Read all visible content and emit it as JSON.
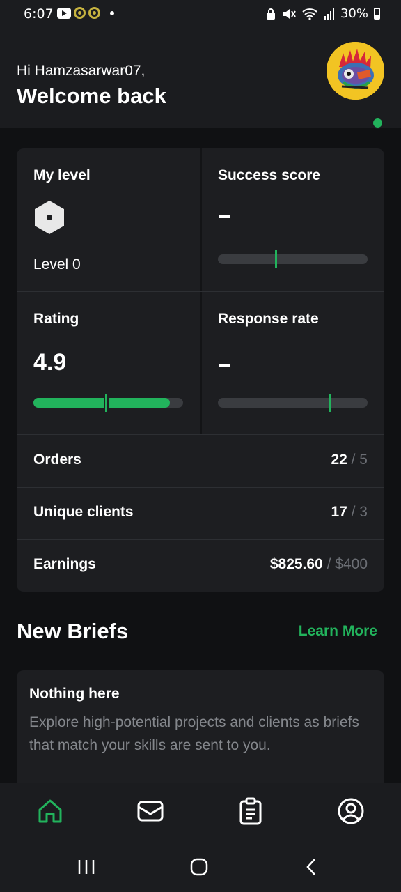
{
  "status_bar": {
    "time": "6:07",
    "battery": "30%"
  },
  "header": {
    "greeting": "Hi Hamzasarwar07,",
    "welcome": "Welcome back"
  },
  "stats": {
    "my_level": {
      "title": "My level",
      "level": "Level 0"
    },
    "success_score": {
      "title": "Success score",
      "value": "-",
      "marker_fraction": 0.38
    },
    "rating": {
      "title": "Rating",
      "value": "4.9",
      "fill_fraction": 0.913,
      "marker_fraction": 0.47
    },
    "response_rate": {
      "title": "Response rate",
      "value": "-",
      "marker_fraction": 0.74
    },
    "orders": {
      "label": "Orders",
      "value": "22",
      "target": "/ 5"
    },
    "unique_clients": {
      "label": "Unique clients",
      "value": "17",
      "target": "/ 3"
    },
    "earnings": {
      "label": "Earnings",
      "value": "$825.60",
      "target": "/ $400"
    }
  },
  "new_briefs": {
    "title": "New Briefs",
    "learn_more": "Learn More",
    "empty_title": "Nothing here",
    "empty_text": "Explore high-potential projects and clients as briefs that match your skills are sent to you."
  },
  "tab_bar": {
    "items": [
      {
        "icon": "home-icon",
        "active": true
      },
      {
        "icon": "inbox-icon",
        "active": false
      },
      {
        "icon": "orders-clipboard-icon",
        "active": false
      },
      {
        "icon": "profile-icon",
        "active": false
      }
    ]
  },
  "colors": {
    "accent": "#22b35c",
    "background": "#101113",
    "card": "#1d1e21"
  }
}
